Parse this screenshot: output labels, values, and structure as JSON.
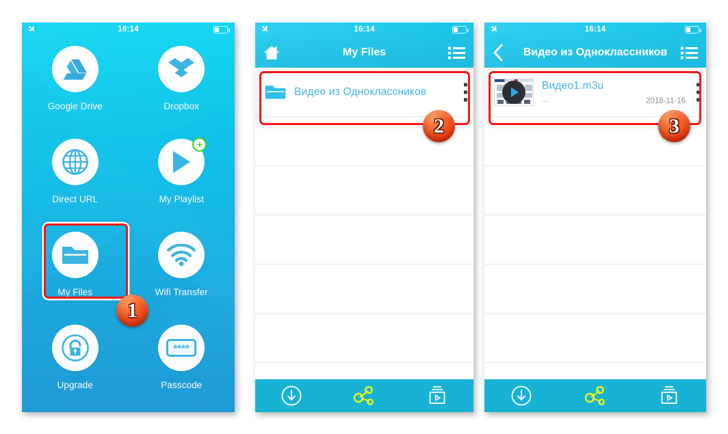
{
  "statusbar": {
    "time": "16:14",
    "airplane_icon": "airplane-mode-icon",
    "battery_icon": "battery-low-icon"
  },
  "panel1": {
    "tiles": [
      {
        "label": "Google Drive",
        "icon": "google-drive-icon"
      },
      {
        "label": "Dropbox",
        "icon": "dropbox-icon"
      },
      {
        "label": "Direct URL",
        "icon": "globe-icon"
      },
      {
        "label": "My Playlist",
        "icon": "play-icon",
        "badge": "+"
      },
      {
        "label": "My Files",
        "icon": "folder-icon"
      },
      {
        "label": "Wifi Transfer",
        "icon": "wifi-icon"
      },
      {
        "label": "Upgrade",
        "icon": "unlock-icon"
      },
      {
        "label": "Passcode",
        "icon": "passcode-icon",
        "glyph": "****"
      }
    ]
  },
  "panel2": {
    "nav": {
      "title": "My Files",
      "left_icon": "home-icon",
      "right_icon": "list-view-icon"
    },
    "rows": [
      {
        "name": "Видео из Одноклассников",
        "icon": "folder-icon",
        "menu_icon": "more-vertical-icon"
      }
    ]
  },
  "panel3": {
    "nav": {
      "title": "Видео из Одноклассников",
      "left_icon": "back-chevron-icon",
      "right_icon": "list-view-icon"
    },
    "rows": [
      {
        "name": "Видео1.m3u",
        "sub": "...",
        "date": "2018-11-16",
        "icon": "video-thumbnail",
        "menu_icon": "more-vertical-icon"
      }
    ]
  },
  "toolbar": {
    "buttons": [
      {
        "icon": "download-icon",
        "color": "#ffffff"
      },
      {
        "icon": "share-nodes-icon",
        "color": "#eaf718"
      },
      {
        "icon": "media-library-icon",
        "color": "#ffffff"
      }
    ]
  },
  "annotations": {
    "steps": [
      {
        "number": "1"
      },
      {
        "number": "2"
      },
      {
        "number": "3"
      }
    ],
    "highlight_color": "#f51616",
    "badge_color": "#e8380e"
  }
}
